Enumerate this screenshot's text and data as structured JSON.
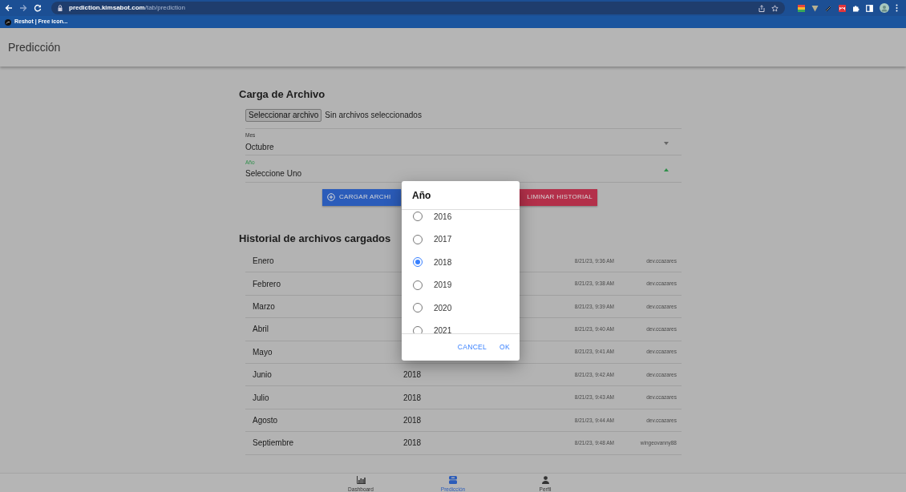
{
  "browser": {
    "url_host": "prediction.kimsabot.com",
    "url_path": "/tab/prediction",
    "bookmarks": [
      {
        "label": "Reshot | Free icon..."
      }
    ]
  },
  "header": {
    "title": "Predicción"
  },
  "upload": {
    "title": "Carga de Archivo",
    "file_button": "Seleccionar archivo",
    "file_status": "Sin archivos seleccionados",
    "fields": [
      {
        "label": "Mes",
        "value": "Octubre",
        "expanded": false
      },
      {
        "label": "Año",
        "value": "Seleccione Uno",
        "expanded": true
      }
    ],
    "buttons": [
      {
        "kind": "upload",
        "label": "CARGAR ARCHI"
      },
      {
        "kind": "delete",
        "label": "LIMINAR HISTORIAL"
      }
    ]
  },
  "history": {
    "title": "Historial de archivos cargados",
    "rows": [
      {
        "month": "Enero",
        "date": "8/21/23, 9:36 AM",
        "user": "dev.ccazares"
      },
      {
        "month": "Febrero",
        "date": "8/21/23, 9:38 AM",
        "user": "dev.ccazares"
      },
      {
        "month": "Marzo",
        "date": "8/21/23, 9:39 AM",
        "user": "dev.ccazares"
      },
      {
        "month": "Abril",
        "date": "8/21/23, 9:40 AM",
        "user": "dev.ccazares"
      },
      {
        "month": "Mayo",
        "date": "8/21/23, 9:41 AM",
        "user": "dev.ccazares"
      },
      {
        "month": "Junio",
        "year": "2018",
        "date": "8/21/23, 9:42 AM",
        "user": "dev.ccazares"
      },
      {
        "month": "Julio",
        "year": "2018",
        "date": "8/21/23, 9:43 AM",
        "user": "dev.ccazares"
      },
      {
        "month": "Agosto",
        "year": "2018",
        "date": "8/21/23, 9:44 AM",
        "user": "dev.ccazares"
      },
      {
        "month": "Septiembre",
        "year": "2018",
        "date": "8/21/23, 9:48 AM",
        "user": "wingeovanny88"
      }
    ]
  },
  "dialog": {
    "title": "Año",
    "options": [
      {
        "label": "2016",
        "selected": false
      },
      {
        "label": "2017",
        "selected": false
      },
      {
        "label": "2018",
        "selected": true
      },
      {
        "label": "2019",
        "selected": false
      },
      {
        "label": "2020",
        "selected": false
      },
      {
        "label": "2021",
        "selected": false
      }
    ],
    "buttons": [
      "CANCEL",
      "OK"
    ]
  },
  "tabs": [
    {
      "label": "Dashboard",
      "kind": "chart",
      "selected": false
    },
    {
      "label": "Predicción",
      "kind": "box",
      "selected": true
    },
    {
      "label": "Perfil",
      "kind": "person",
      "selected": false
    }
  ]
}
